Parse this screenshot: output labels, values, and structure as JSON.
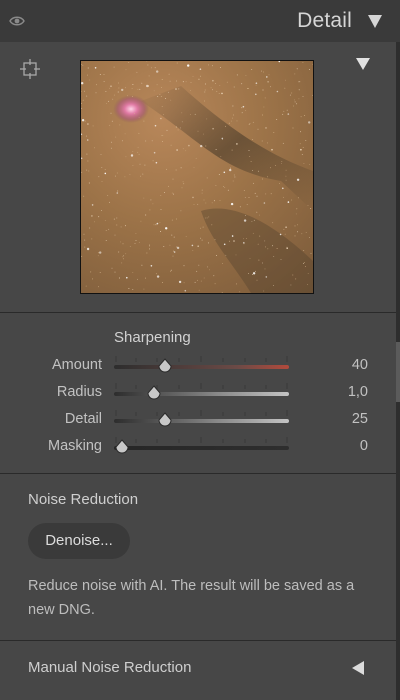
{
  "header": {
    "title": "Detail",
    "visibility_icon": "eye-icon",
    "collapse_icon": "triangle-down-icon"
  },
  "preview": {
    "target_icon": "crosshair-target-icon",
    "toggle_icon": "triangle-down-icon"
  },
  "sharpening": {
    "heading": "Sharpening",
    "sliders": [
      {
        "label": "Amount",
        "value": "40",
        "fraction": 0.27,
        "track": "gradient-red"
      },
      {
        "label": "Radius",
        "value": "1,0",
        "fraction": 0.2,
        "track": "gradient-light"
      },
      {
        "label": "Detail",
        "value": "25",
        "fraction": 0.27,
        "track": "gradient-light"
      },
      {
        "label": "Masking",
        "value": "0",
        "fraction": 0.0,
        "track": "gradient-dark"
      }
    ]
  },
  "noise_reduction": {
    "heading": "Noise Reduction",
    "denoise_label": "Denoise...",
    "description": "Reduce noise with AI. The result will be saved as a new DNG."
  },
  "manual_noise_reduction": {
    "label": "Manual Noise Reduction",
    "expand_icon": "triangle-left-icon"
  },
  "colors": {
    "panel_bg": "#474747",
    "header_bg": "#3a3a3a",
    "text": "#cfcfcf",
    "amount_track_accent": "#b24a3c"
  }
}
